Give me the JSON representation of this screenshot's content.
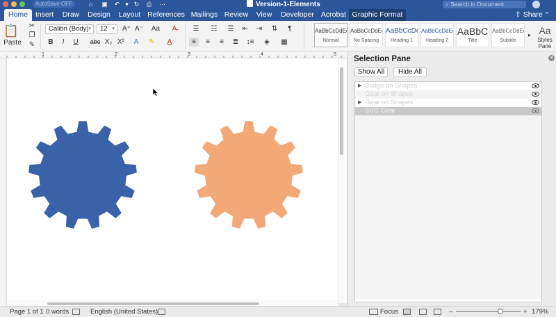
{
  "window": {
    "title": "Version-1-Elements",
    "autosave": "AutoSave  OFF"
  },
  "search": {
    "placeholder": "Search in Document"
  },
  "tabs": [
    {
      "label": "Home",
      "active": true
    },
    {
      "label": "Insert"
    },
    {
      "label": "Draw"
    },
    {
      "label": "Design"
    },
    {
      "label": "Layout"
    },
    {
      "label": "References"
    },
    {
      "label": "Mailings"
    },
    {
      "label": "Review"
    },
    {
      "label": "View"
    },
    {
      "label": "Developer"
    },
    {
      "label": "Acrobat"
    },
    {
      "label": "Graphic Format",
      "contextual": true
    }
  ],
  "share_label": "Share",
  "ribbon": {
    "paste_label": "Paste",
    "font_name": "Calibri (Body)",
    "font_size": "12",
    "styles": [
      {
        "sample": "AaBbCcDdEe",
        "name": "Normal",
        "selected": true
      },
      {
        "sample": "AaBbCcDdEe",
        "name": "No Spacing"
      },
      {
        "sample": "AaBbCcDc",
        "name": "Heading 1"
      },
      {
        "sample": "AaBbCcDdEe",
        "name": "Heading 2"
      },
      {
        "sample": "AaBbC",
        "name": "Title"
      },
      {
        "sample": "AaBbCcDdEe",
        "name": "Subtitle"
      }
    ],
    "styles_pane_label": "Styles Pane"
  },
  "ruler_numbers": [
    "1",
    "2",
    "3",
    "4",
    "5"
  ],
  "canvas": {
    "gears": [
      {
        "name": "blue-gear",
        "color": "#3a62a8"
      },
      {
        "name": "orange-gear",
        "color": "#f2a877"
      }
    ]
  },
  "selection_pane": {
    "title": "Selection Pane",
    "show_all": "Show All",
    "hide_all": "Hide All",
    "items": [
      {
        "label": "Badge on Shapes",
        "has_arrow": true,
        "visible": true
      },
      {
        "label": "Gear on Shapes",
        "has_arrow": false,
        "visible": true
      },
      {
        "label": "Gear on Shapes",
        "has_arrow": true,
        "visible": true
      },
      {
        "label": "SVG Gear",
        "has_arrow": false,
        "visible": true,
        "selected": true
      }
    ]
  },
  "status": {
    "page": "Page 1 of 1",
    "words": "0 words",
    "language": "English (United States)",
    "focus": "Focus",
    "zoom": "179%",
    "zoom_minus": "–",
    "zoom_plus": "+"
  }
}
